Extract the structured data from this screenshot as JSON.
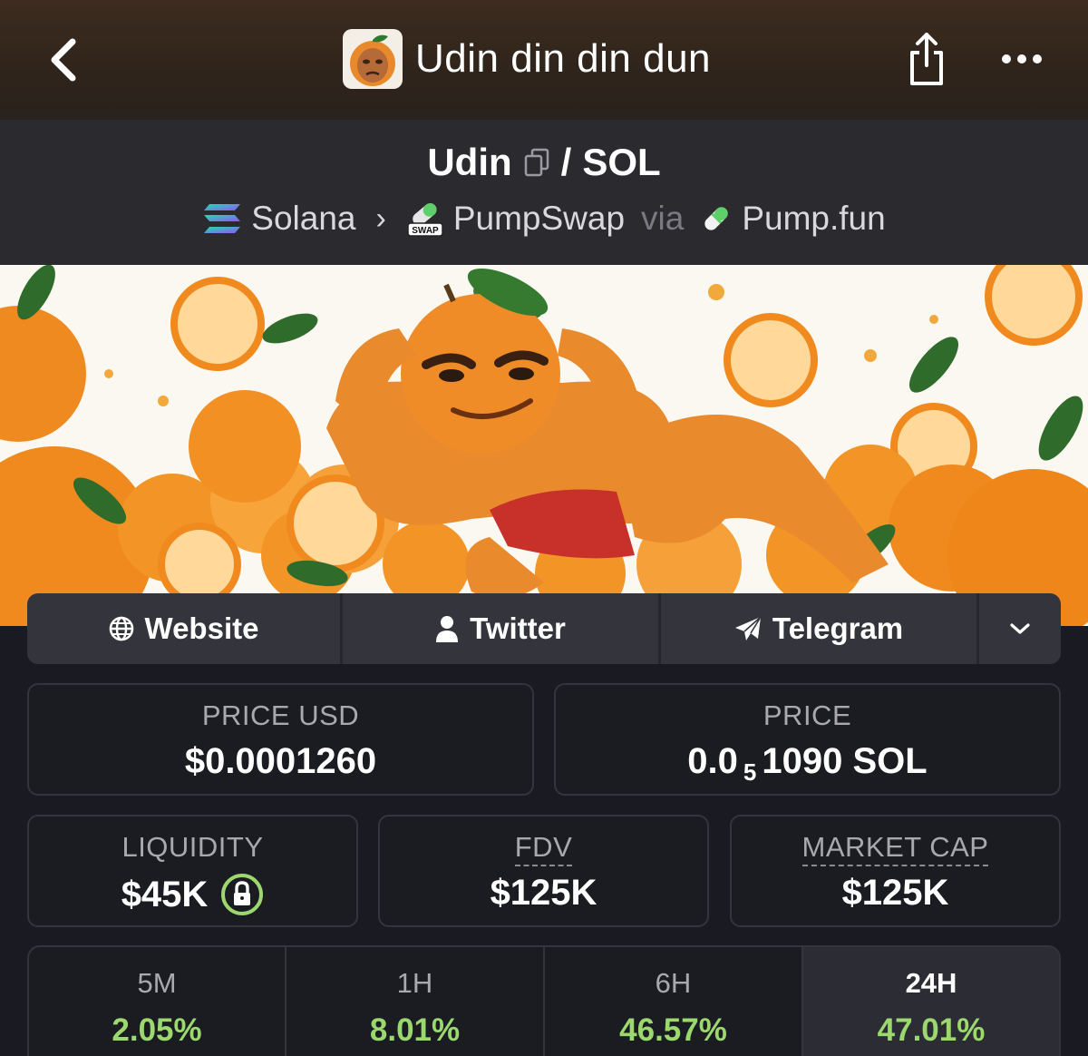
{
  "header": {
    "title": "Udin din din dun"
  },
  "pair": {
    "base": "Udin",
    "separator": "/",
    "quote": "SOL",
    "chain": "Solana",
    "dex": "PumpSwap",
    "dex_badge": "SWAP",
    "via": "via",
    "launchpad": "Pump.fun"
  },
  "socials": {
    "website": "Website",
    "twitter": "Twitter",
    "telegram": "Telegram"
  },
  "stats": {
    "price_usd_label": "PRICE USD",
    "price_usd_value": "$0.0001260",
    "price_label": "PRICE",
    "price_prefix": "0.0",
    "price_zero_count": "5",
    "price_digits": "1090 SOL",
    "liquidity_label": "LIQUIDITY",
    "liquidity_value": "$45K",
    "fdv_label": "FDV",
    "fdv_value": "$125K",
    "mcap_label": "MARKET CAP",
    "mcap_value": "$125K"
  },
  "timeframes": [
    {
      "label": "5M",
      "value": "2.05%"
    },
    {
      "label": "1H",
      "value": "8.01%"
    },
    {
      "label": "6H",
      "value": "46.57%"
    },
    {
      "label": "24H",
      "value": "47.01%"
    }
  ],
  "icons": {
    "back": "chevron-left-icon",
    "share": "share-icon",
    "more": "more-icon",
    "copy": "copy-icon",
    "chain": "solana-icon",
    "dex": "pumpswap-icon",
    "launchpad": "pill-icon",
    "website": "globe-icon",
    "twitter": "user-icon",
    "telegram": "paper-plane-icon",
    "expand": "chevron-down-icon",
    "lock": "lock-icon"
  },
  "colors": {
    "background": "#1a1b22",
    "positive": "#9bd86e",
    "lock": "#9bd86e",
    "card_border": "#34353b"
  }
}
